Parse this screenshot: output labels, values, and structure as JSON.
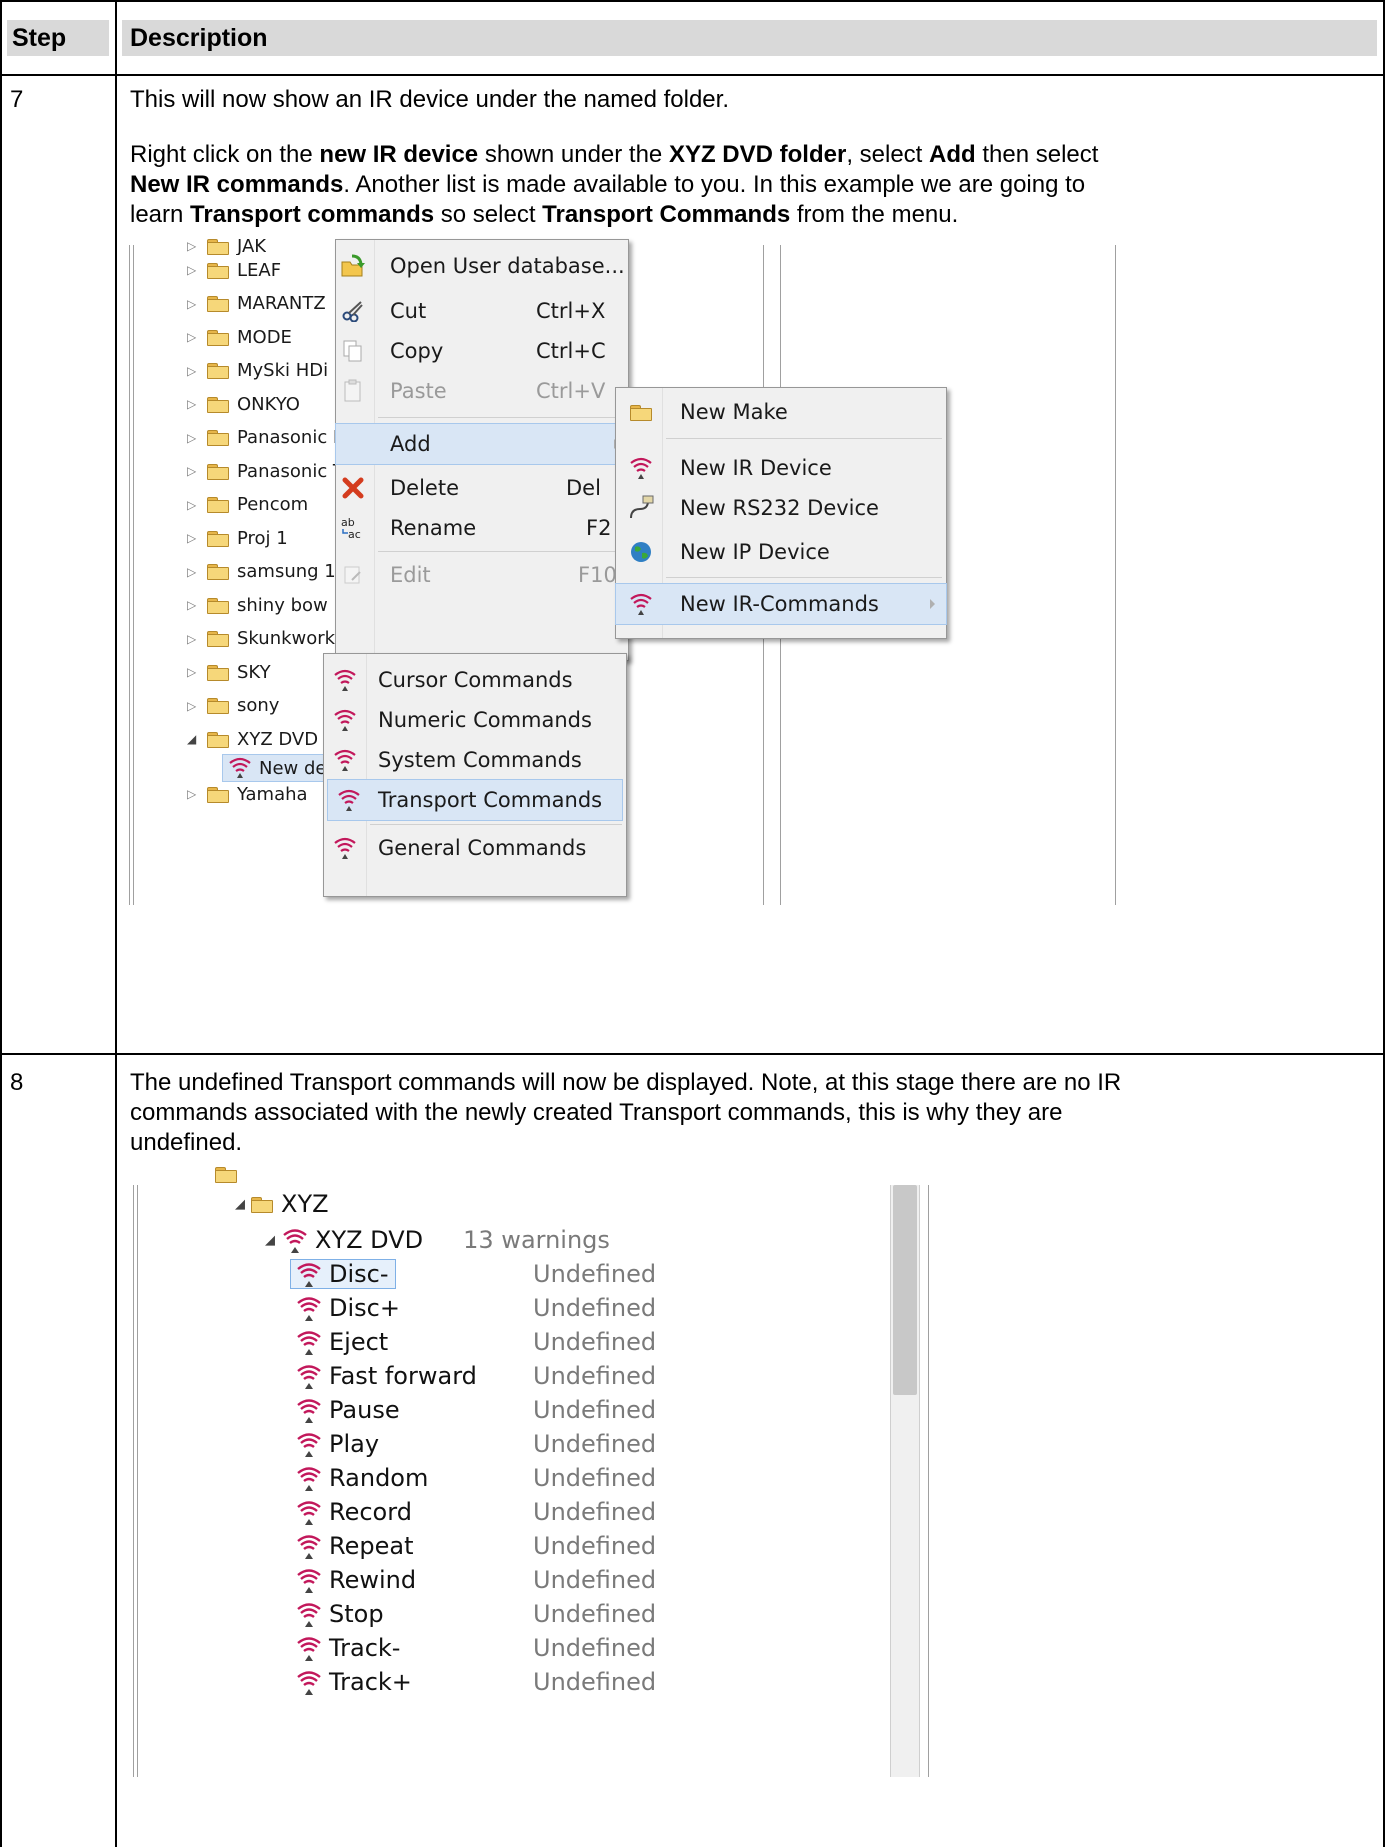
{
  "table": {
    "header": {
      "step": "Step",
      "description": "Description"
    }
  },
  "step7": {
    "number": "7",
    "line1": "This will now show an IR device under the named folder.",
    "p2": {
      "t1": "Right click on the ",
      "b1": "new IR device",
      "t2": " shown under the ",
      "b2": "XYZ DVD folder",
      "t3": ", select ",
      "b3": "Add",
      "t4": " then select",
      "b4": "New IR commands",
      "t5": ". Another list is made available to you. In this example we are going to",
      "t6": "learn ",
      "b5": "Transport commands",
      "t7": " so select ",
      "b6": "Transport Commands",
      "t8": " from the menu."
    },
    "tree": {
      "partial_top": "JAK",
      "folders": [
        "LEAF",
        "MARANTZ",
        "MODE",
        "MySki HDi",
        "ONKYO",
        "Panasonic BluR",
        "Panasonic TV",
        "Pencom",
        "Proj 1",
        "samsung 1",
        "shiny bow",
        "Skunkworks",
        "SKY",
        "sony",
        "XYZ DVD"
      ],
      "child": "New device",
      "after": "Yamaha"
    },
    "context_menu": {
      "items": [
        {
          "label": "Open User database...",
          "shortcut": ""
        },
        {
          "label": "Cut",
          "shortcut": "Ctrl+X"
        },
        {
          "label": "Copy",
          "shortcut": "Ctrl+C"
        },
        {
          "label": "Paste",
          "shortcut": "Ctrl+V"
        },
        {
          "label": "Add",
          "shortcut": ""
        },
        {
          "label": "Delete",
          "shortcut": "Del"
        },
        {
          "label": "Rename",
          "shortcut": "F2"
        },
        {
          "label": "Edit",
          "shortcut": "F10"
        }
      ]
    },
    "add_submenu": {
      "items": [
        "New Make",
        "New IR Device",
        "New RS232 Device",
        "New IP Device",
        "New IR-Commands"
      ]
    },
    "commands_submenu": {
      "items": [
        "Cursor Commands",
        "Numeric Commands",
        "System Commands",
        "Transport Commands",
        "General Commands"
      ]
    },
    "colors": {
      "ir_icon": "#c2185b",
      "highlight": "#d9e6f5",
      "folder": "#f6d77a"
    }
  },
  "step8": {
    "number": "8",
    "line1": "The undefined Transport commands will now be displayed.  Note, at this stage there are no IR",
    "line2": "commands associated with the newly created Transport commands, this is why they are",
    "line3": "undefined.",
    "tree": {
      "folder": "XYZ",
      "device": "XYZ DVD",
      "warnings": "13 warnings",
      "commands": [
        {
          "name": "Disc-",
          "status": "Undefined"
        },
        {
          "name": "Disc+",
          "status": "Undefined"
        },
        {
          "name": "Eject",
          "status": "Undefined"
        },
        {
          "name": "Fast forward",
          "status": "Undefined"
        },
        {
          "name": "Pause",
          "status": "Undefined"
        },
        {
          "name": "Play",
          "status": "Undefined"
        },
        {
          "name": "Random",
          "status": "Undefined"
        },
        {
          "name": "Record",
          "status": "Undefined"
        },
        {
          "name": "Repeat",
          "status": "Undefined"
        },
        {
          "name": "Rewind",
          "status": "Undefined"
        },
        {
          "name": "Stop",
          "status": "Undefined"
        },
        {
          "name": "Track-",
          "status": "Undefined"
        },
        {
          "name": "Track+",
          "status": "Undefined"
        }
      ]
    }
  }
}
